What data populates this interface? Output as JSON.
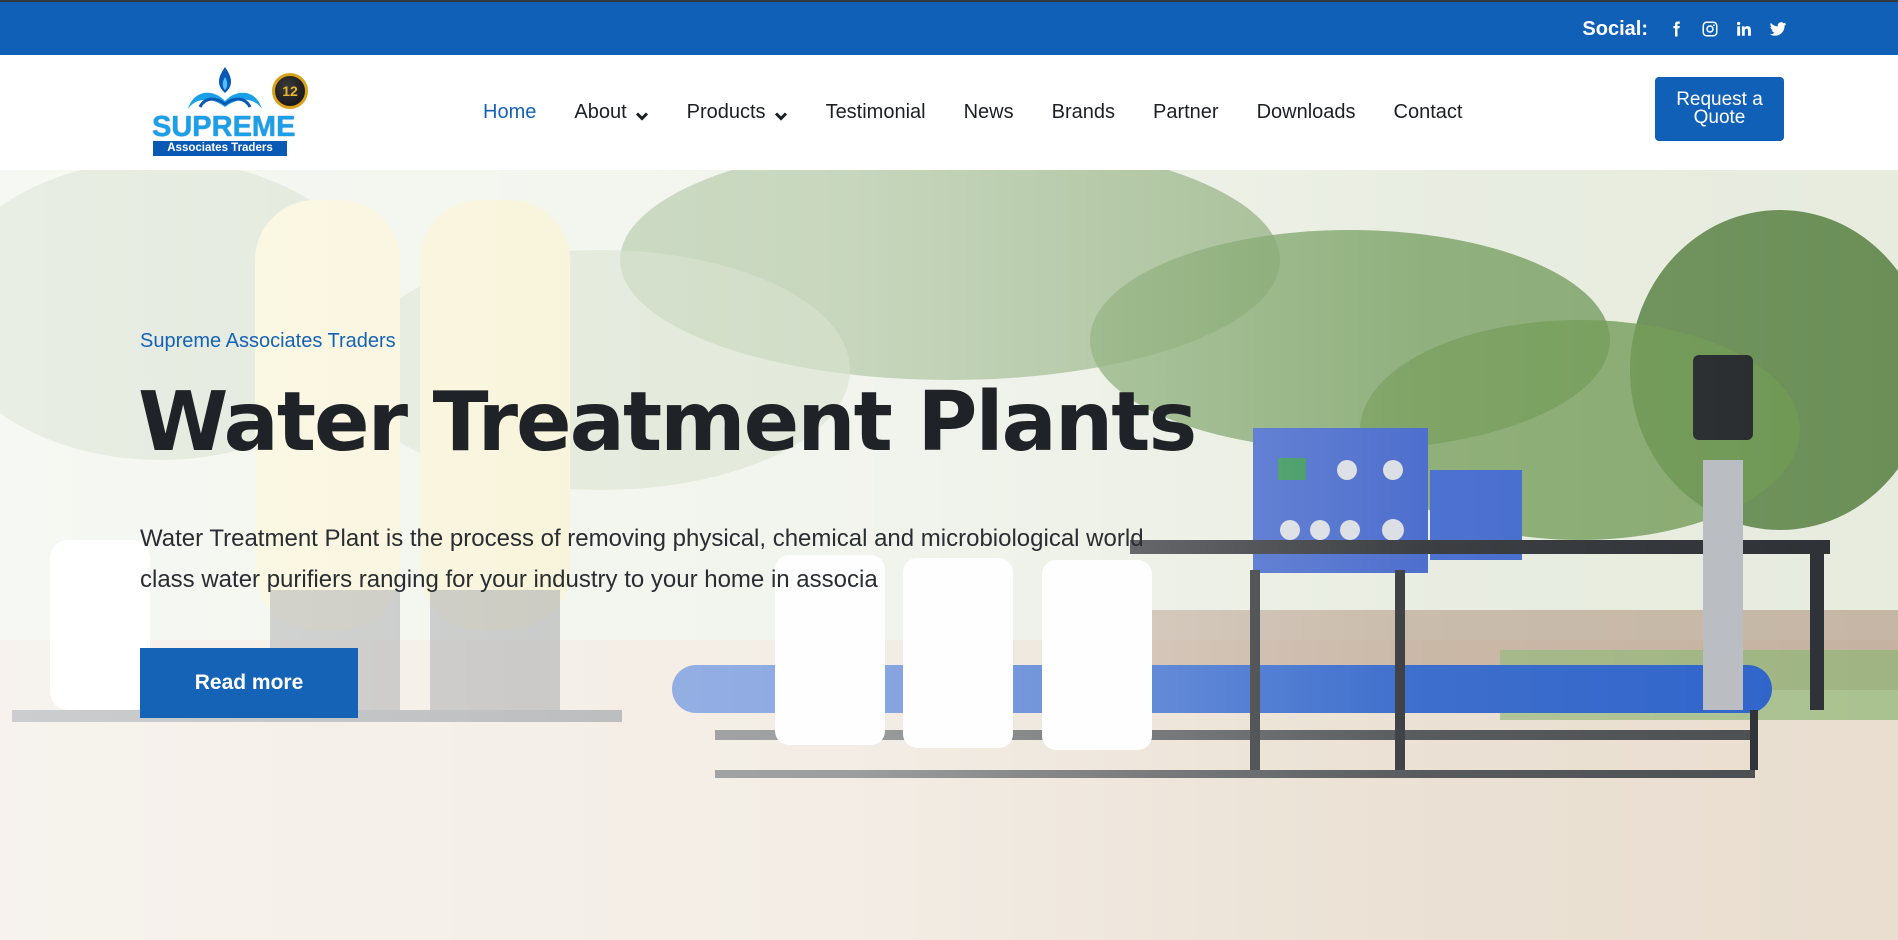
{
  "topbar": {
    "social_label": "Social:",
    "icons": [
      "facebook-icon",
      "instagram-icon",
      "linkedin-icon",
      "twitter-icon"
    ]
  },
  "logo": {
    "word": "SUPREME",
    "sub": "Associates Traders",
    "anniversary": "12"
  },
  "nav": {
    "items": [
      {
        "label": "Home",
        "active": true
      },
      {
        "label": "About",
        "dropdown": true
      },
      {
        "label": "Products",
        "dropdown": true
      },
      {
        "label": "Testimonial"
      },
      {
        "label": "News"
      },
      {
        "label": "Brands"
      },
      {
        "label": "Partner"
      },
      {
        "label": "Downloads"
      },
      {
        "label": "Contact"
      }
    ],
    "quote_button": "Request a Quote"
  },
  "hero": {
    "eyebrow": "Supreme Associates Traders",
    "title": "Water Treatment Plants",
    "description": "Water Treatment Plant is the process of removing physical, chemical and microbiological world class water purifiers ranging for your industry to your home in associa",
    "button": "Read more"
  },
  "colors": {
    "brand_blue": "#1060b8",
    "accent_blue": "#1563b6",
    "text_dark": "#1f2226"
  }
}
